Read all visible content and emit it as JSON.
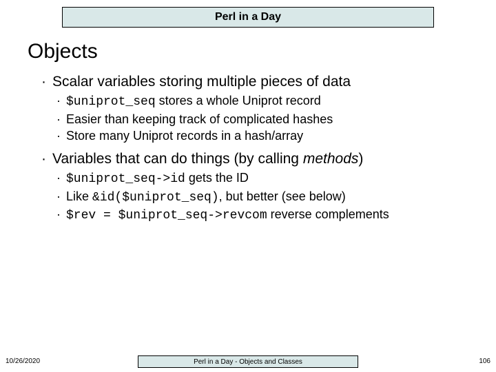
{
  "header": {
    "title": "Perl in a Day"
  },
  "slide": {
    "title": "Objects"
  },
  "b1": {
    "heading": "Scalar variables storing multiple pieces of data",
    "l1_code": "$uniprot_seq",
    "l1_rest": " stores a whole Uniprot record",
    "l2": "Easier than keeping track of complicated hashes",
    "l3": "Store many Uniprot records in a hash/array"
  },
  "b2": {
    "heading_pre": "Variables that can do things (by calling ",
    "heading_em": "methods",
    "heading_post": ")",
    "l1_code": "$uniprot_seq->id",
    "l1_rest": " gets the ID",
    "l2_pre": "Like ",
    "l2_code": "&id($uniprot_seq)",
    "l2_post": ", but better (see below)",
    "l3_code": "$rev = $uniprot_seq->revcom",
    "l3_rest": " reverse complements"
  },
  "footer": {
    "date": "10/26/2020",
    "center": "Perl in a Day - Objects and Classes",
    "page": "106"
  }
}
